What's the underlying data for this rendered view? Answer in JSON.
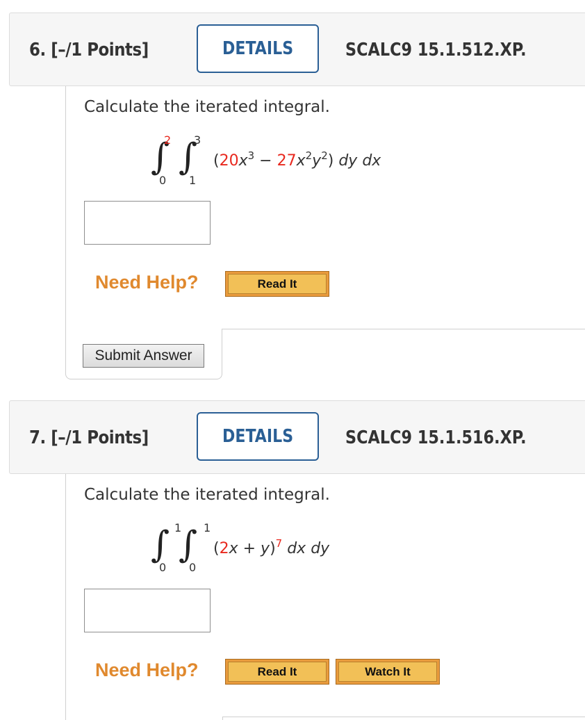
{
  "questions": [
    {
      "number_points": "6.  [–/1 Points]",
      "details_label": "DETAILS",
      "code": "SCALC9 15.1.512.XP.",
      "prompt": "Calculate the iterated integral.",
      "outer_upper": "2",
      "outer_lower": "0",
      "inner_upper": "3",
      "inner_lower": "1",
      "integrand": {
        "open": "(",
        "coef1": "20",
        "var1": "x",
        "exp1": "3",
        "op": " − ",
        "coef2": "27",
        "var2a": "x",
        "exp2a": "2",
        "var2b": "y",
        "exp2b": "2",
        "close": ")",
        "differentials": "dy dx"
      },
      "answer_value": "",
      "need_help": "Need Help?",
      "read_it": "Read It",
      "submit": "Submit Answer"
    },
    {
      "number_points": "7.  [–/1 Points]",
      "details_label": "DETAILS",
      "code": "SCALC9 15.1.516.XP.",
      "prompt": "Calculate the iterated integral.",
      "outer_upper": "1",
      "outer_lower": "0",
      "inner_upper": "1",
      "inner_lower": "0",
      "integrand": {
        "open": "(",
        "coef1": "2",
        "var1": "x",
        "mid": " + ",
        "var2": "y",
        "close": ")",
        "exp": "7",
        "differentials": "dx dy"
      },
      "answer_value": "",
      "need_help": "Need Help?",
      "read_it": "Read It",
      "watch_it": "Watch It"
    }
  ],
  "colors": {
    "accent": "#2a5f95",
    "highlight_red": "#e8281e",
    "help_orange": "#e0892e"
  }
}
